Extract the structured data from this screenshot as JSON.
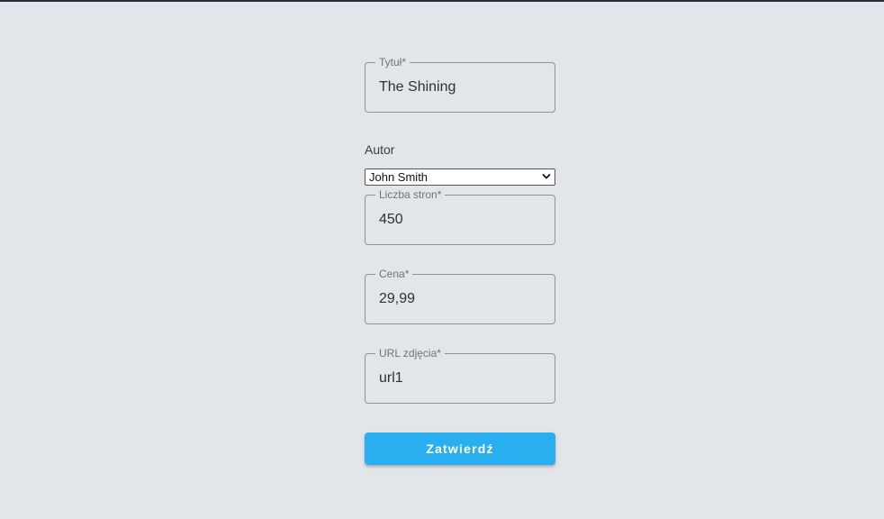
{
  "colors": {
    "background": "#e2e5ea",
    "accent": "#29aef0",
    "top_bar": "#2a2d3a"
  },
  "form": {
    "title": {
      "label": "Tytuł*",
      "value": "The Shining"
    },
    "author": {
      "label": "Autor",
      "selected": "John Smith"
    },
    "pages": {
      "label": "Liczba stron*",
      "value": "450"
    },
    "price": {
      "label": "Cena*",
      "value": "29,99"
    },
    "image_url": {
      "label": "URL zdjęcia*",
      "value": "url1"
    },
    "submit_label": "Zatwierdź"
  },
  "icons": {
    "select_arrow": "chevron-down-icon"
  }
}
